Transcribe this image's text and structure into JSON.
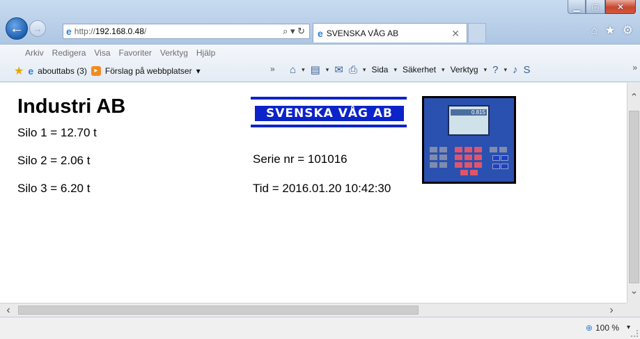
{
  "browser": {
    "address_protocol": "http://",
    "address_host": "192.168.0.48",
    "address_path": "/",
    "tab_title": "SVENSKA VÅG AB",
    "menu": [
      "Arkiv",
      "Redigera",
      "Visa",
      "Favoriter",
      "Verktyg",
      "Hjälp"
    ],
    "favorites": {
      "item1": "abouttabs (3)",
      "item2": "Förslag på webbplatser"
    },
    "commands": {
      "page": "Sida",
      "safety": "Säkerhet",
      "tools": "Verktyg"
    },
    "zoom": "100 %"
  },
  "page": {
    "company": "Industri AB",
    "silos": [
      "Silo 1 = 12.70 t",
      "Silo 2 = 2.06 t",
      "Silo 3 = 6.20 t"
    ],
    "logo_text": "SVENSKA VÅG AB",
    "serial": "Serie nr = 101016",
    "time": "Tid = 2016.01.20 10:42:30",
    "device_display_value": "0.815",
    "colors": {
      "logo_blue": "#0b23c9",
      "device_blue": "#2a50b0",
      "keypad_red": "#e0556a"
    }
  }
}
